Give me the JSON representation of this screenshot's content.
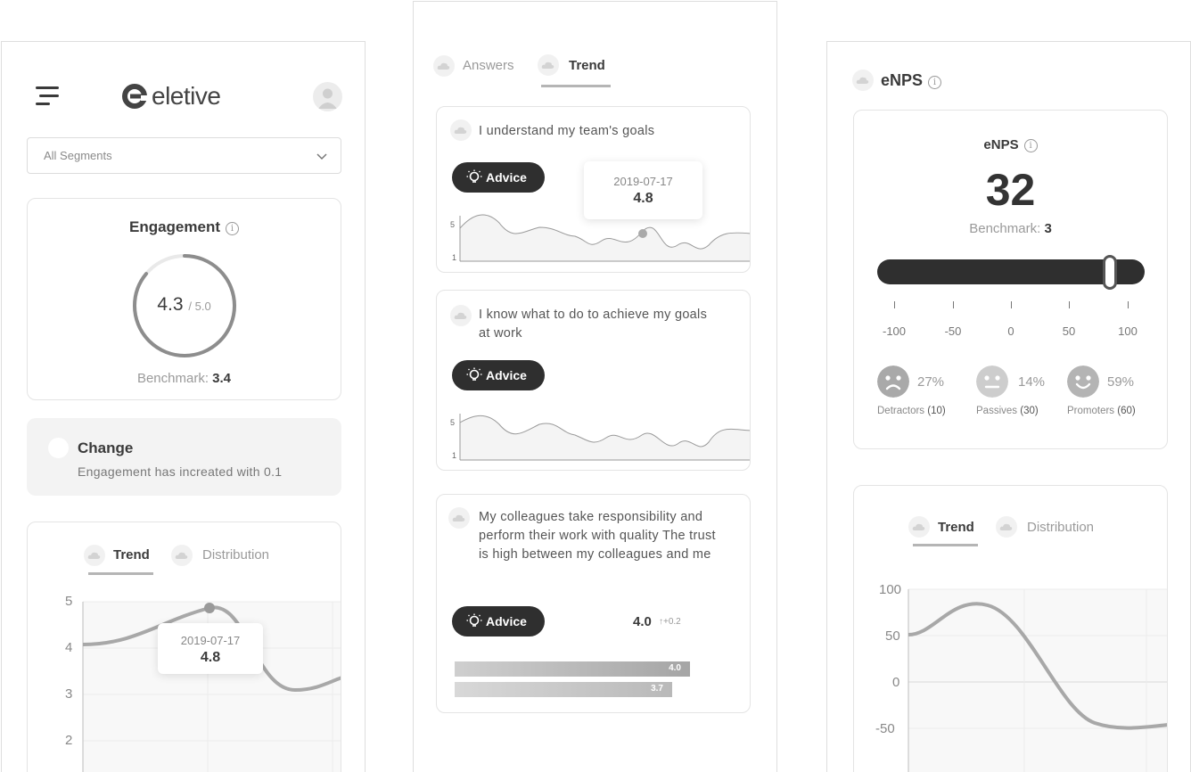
{
  "left": {
    "app_name": "eletive",
    "segment_select": {
      "value": "All Segments"
    },
    "engagement": {
      "title": "Engagement",
      "score": "4.3",
      "max": "/ 5.0",
      "score_fraction": 0.86,
      "benchmark_label": "Benchmark:",
      "benchmark_value": "3.4"
    },
    "change": {
      "title": "Change",
      "text": "Engagement has increated with 0.1"
    },
    "trend_card": {
      "tabs": [
        {
          "label": "Trend",
          "active": true
        },
        {
          "label": "Distribution",
          "active": false
        }
      ],
      "y_ticks": [
        "5",
        "4",
        "3",
        "2"
      ],
      "tooltip": {
        "date": "2019-07-17",
        "value": "4.8"
      }
    }
  },
  "middle": {
    "tabs": [
      {
        "label": "Answers",
        "active": false
      },
      {
        "label": "Trend",
        "active": true
      }
    ],
    "questions": [
      {
        "text": "I understand my team's goals",
        "advice_label": "Advice",
        "y_top": "5",
        "y_bottom": "1",
        "tooltip": {
          "date": "2019-07-17",
          "value": "4.8"
        }
      },
      {
        "text": "I know what to do to achieve my goals at work",
        "advice_label": "Advice",
        "y_top": "5",
        "y_bottom": "1"
      },
      {
        "text": "My colleagues take responsibility and perform their work with quality The trust is high between my colleagues and me",
        "advice_label": "Advice",
        "score": "4.0",
        "delta": "↑+0.2",
        "bars": [
          {
            "label": "4.0",
            "value": 4.0
          },
          {
            "label": "3.7",
            "value": 3.7
          }
        ]
      }
    ]
  },
  "right": {
    "header": "eNPS",
    "card": {
      "title": "eNPS",
      "score": "32",
      "benchmark_label": "Benchmark:",
      "benchmark_value": "3",
      "slider_value": 74,
      "scale": [
        "-100",
        "-50",
        "0",
        "50",
        "100"
      ],
      "groups": [
        {
          "pct": "27%",
          "name": "Detractors",
          "count": "(10)"
        },
        {
          "pct": "14%",
          "name": "Passives",
          "count": "(30)"
        },
        {
          "pct": "59%",
          "name": "Promoters",
          "count": "(60)"
        }
      ]
    },
    "trend_card": {
      "tabs": [
        {
          "label": "Trend",
          "active": true
        },
        {
          "label": "Distribution",
          "active": false
        }
      ],
      "y_ticks": [
        "100",
        "50",
        "0",
        "-50"
      ]
    }
  }
}
